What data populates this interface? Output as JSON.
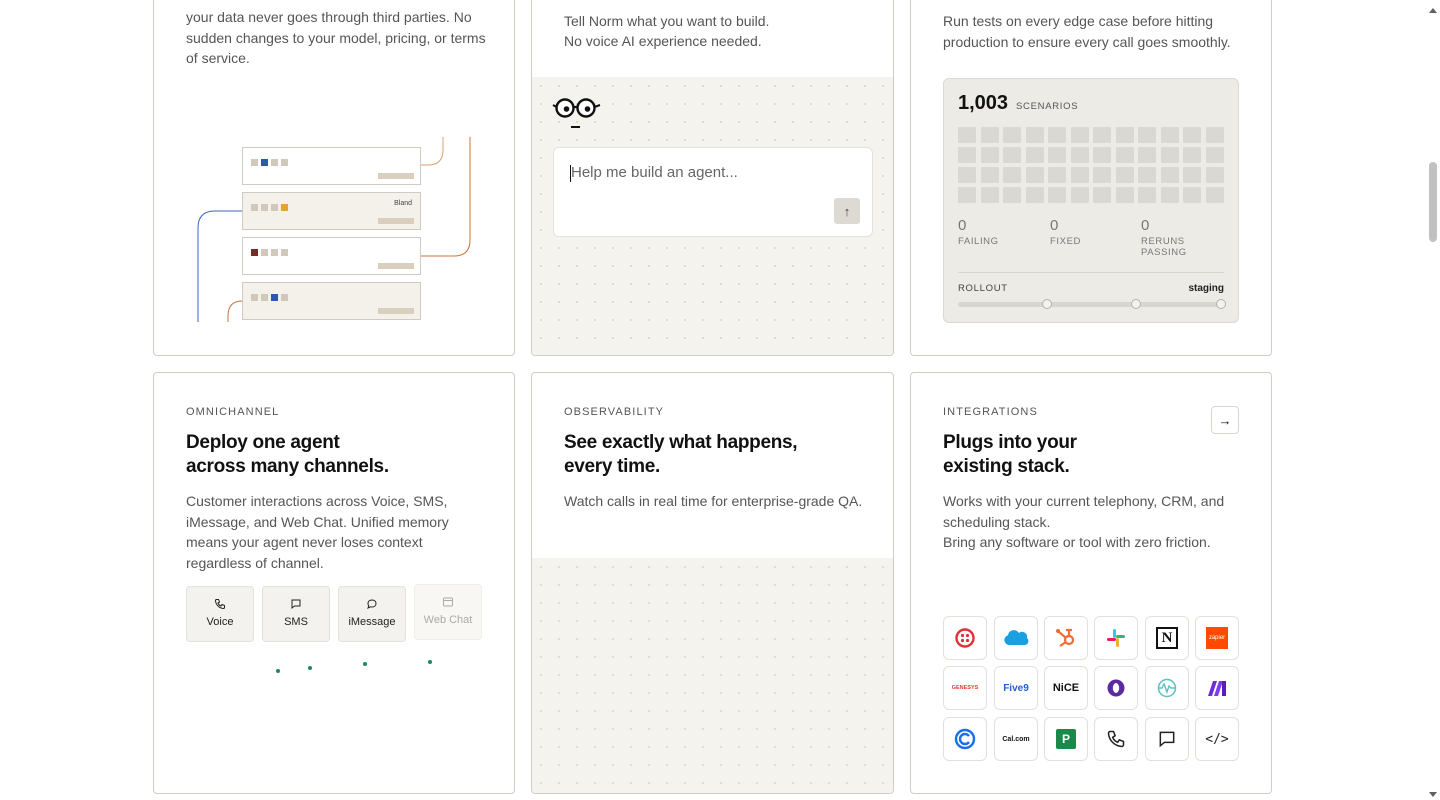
{
  "top_left": {
    "desc": "your data never goes through third parties. No sudden changes to your model, pricing, or terms of service.",
    "server_label": "Bland"
  },
  "top_mid": {
    "desc_line1": "Tell Norm what you want to build.",
    "desc_line2": "No voice AI experience needed.",
    "prompt_placeholder": "Help me build an agent...",
    "send_glyph": "↑"
  },
  "top_right": {
    "desc": "Run tests on every edge case before hitting production to ensure every call goes smoothly.",
    "scenarios_count": "1,003",
    "scenarios_label": "SCENARIOS",
    "stats": [
      {
        "value": "0",
        "label": "FAILING"
      },
      {
        "value": "0",
        "label": "FIXED"
      },
      {
        "value": "0",
        "label": "RERUNS PASSING"
      }
    ],
    "rollout_label": "ROLLOUT",
    "rollout_stage": "staging"
  },
  "omnichannel": {
    "eyebrow": "OMNICHANNEL",
    "heading_line1": "Deploy one agent",
    "heading_line2": "across many channels.",
    "desc": "Customer interactions across Voice, SMS, iMessage, and Web Chat. Unified memory means your agent never loses context regardless of channel.",
    "channels": [
      {
        "label": "Voice",
        "icon": "phone-icon"
      },
      {
        "label": "SMS",
        "icon": "message-icon"
      },
      {
        "label": "iMessage",
        "icon": "chat-bubble-icon"
      },
      {
        "label": "Web Chat",
        "icon": "browser-icon"
      }
    ]
  },
  "observability": {
    "eyebrow": "OBSERVABILITY",
    "heading_line1": "See exactly what happens,",
    "heading_line2": "every time.",
    "desc": "Watch calls in real time for enterprise-grade QA."
  },
  "integrations": {
    "eyebrow": "INTEGRATIONS",
    "heading_line1": "Plugs into your",
    "heading_line2": "existing stack.",
    "desc_line1": "Works with your current telephony, CRM, and scheduling stack.",
    "desc_line2": "Bring any software or tool with zero friction.",
    "arrow_glyph": "→",
    "logos": [
      {
        "name": "twilio-icon",
        "text": ""
      },
      {
        "name": "salesforce-icon",
        "text": ""
      },
      {
        "name": "hubspot-icon",
        "text": ""
      },
      {
        "name": "slack-icon",
        "text": ""
      },
      {
        "name": "notion-icon",
        "text": "N"
      },
      {
        "name": "zapier-icon",
        "text": "zapier"
      },
      {
        "name": "genesys-icon",
        "text": "GENESYS"
      },
      {
        "name": "five9-icon",
        "text": "Five9"
      },
      {
        "name": "nice-icon",
        "text": "NiCE"
      },
      {
        "name": "o-logo-icon",
        "text": ""
      },
      {
        "name": "wave-logo-icon",
        "text": ""
      },
      {
        "name": "make-icon",
        "text": ""
      },
      {
        "name": "calendly-icon",
        "text": ""
      },
      {
        "name": "calcom-icon",
        "text": "Cal.com"
      },
      {
        "name": "p-logo-icon",
        "text": "P"
      },
      {
        "name": "phone-icon",
        "text": ""
      },
      {
        "name": "chat-icon",
        "text": ""
      },
      {
        "name": "code-icon",
        "text": "</>"
      }
    ]
  },
  "colors": {
    "accent_blue": "#2563b8",
    "accent_orange": "#d9772b",
    "status_green": "#1f8a55",
    "zapier_orange": "#ff4a00"
  }
}
